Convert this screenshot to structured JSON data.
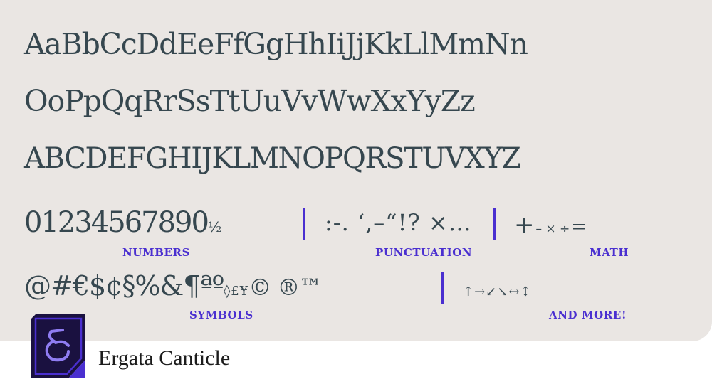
{
  "rows": {
    "mixed_1": "AaBbCcDdEeFfGgHhIiJjKkLlMmNn",
    "mixed_2": "OoPpQqRrSsTtUuVvWwXxYyZz",
    "caps": "ABCDEFGHIJKLMNOPQRSTUVXYZ"
  },
  "numbers": {
    "digits": "01234567890",
    "fraction": "½",
    "label": "NUMBERS"
  },
  "punctuation": {
    "glyphs": ":-. ‘,–“!? ×…",
    "label": "PUNCTUATION"
  },
  "math": {
    "plus": "+",
    "ops": "– × ÷",
    "equals": "=",
    "label": "MATH"
  },
  "symbols": {
    "glyphs": "@#€$¢§%&¶ªº",
    "small": "◊£¥",
    "marks": "© ®™",
    "label": "SYMBOLS"
  },
  "arrows": {
    "glyphs": "↑→↙↘↔↕",
    "label": "AND MORE!"
  },
  "brand": {
    "name": "Ergata Canticle"
  },
  "colors": {
    "background": "#eae6e3",
    "ink": "#36474f",
    "accent": "#4a2fd0",
    "logo_dark": "#1a1140"
  },
  "icons": {
    "logo": "ampersand-logo-icon"
  }
}
